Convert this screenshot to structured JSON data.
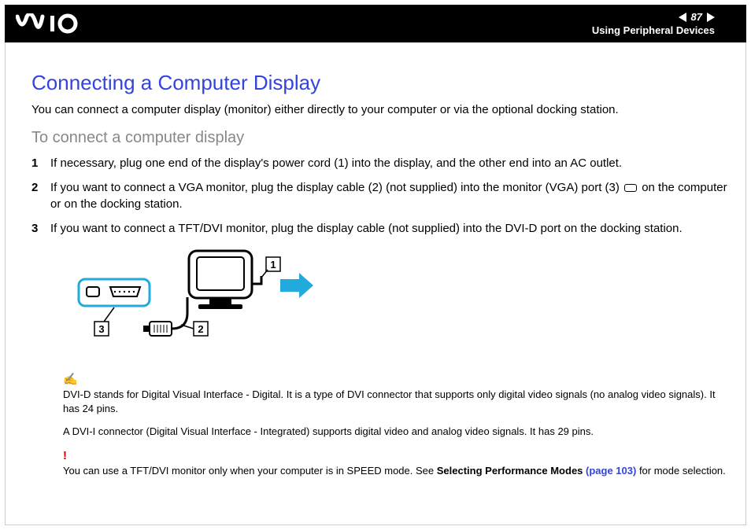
{
  "header": {
    "logo_text": "VAIO",
    "page_number": "87",
    "breadcrumb": "Using Peripheral Devices"
  },
  "content": {
    "title": "Connecting a Computer Display",
    "intro": "You can connect a computer display (monitor) either directly to your computer or via the optional docking station.",
    "sub_title": "To connect a computer display",
    "steps": [
      {
        "n": "1",
        "text": "If necessary, plug one end of the display's power cord (1) into the display, and the other end into an AC outlet."
      },
      {
        "n": "2",
        "text_pre": "If you want to connect a VGA monitor, plug the display cable (2) (not supplied) into the monitor (VGA) port (3) ",
        "text_post": " on the computer or on the docking station."
      },
      {
        "n": "3",
        "text": "If you want to connect a TFT/DVI monitor, plug the display cable (not supplied) into the DVI-D port on the docking station."
      }
    ],
    "diagram_labels": {
      "l1": "1",
      "l2": "2",
      "l3": "3"
    },
    "note1": "DVI-D stands for Digital Visual Interface - Digital. It is a type of DVI connector that supports only digital video signals (no analog video signals). It has 24 pins.",
    "note2": "A DVI-I connector (Digital Visual Interface - Integrated) supports digital video and analog video signals. It has 29 pins.",
    "warn_pre": "You can use a TFT/DVI monitor only when your computer is in SPEED mode. See ",
    "warn_bold": "Selecting Performance Modes ",
    "warn_link": "(page 103)",
    "warn_post": " for mode selection."
  }
}
